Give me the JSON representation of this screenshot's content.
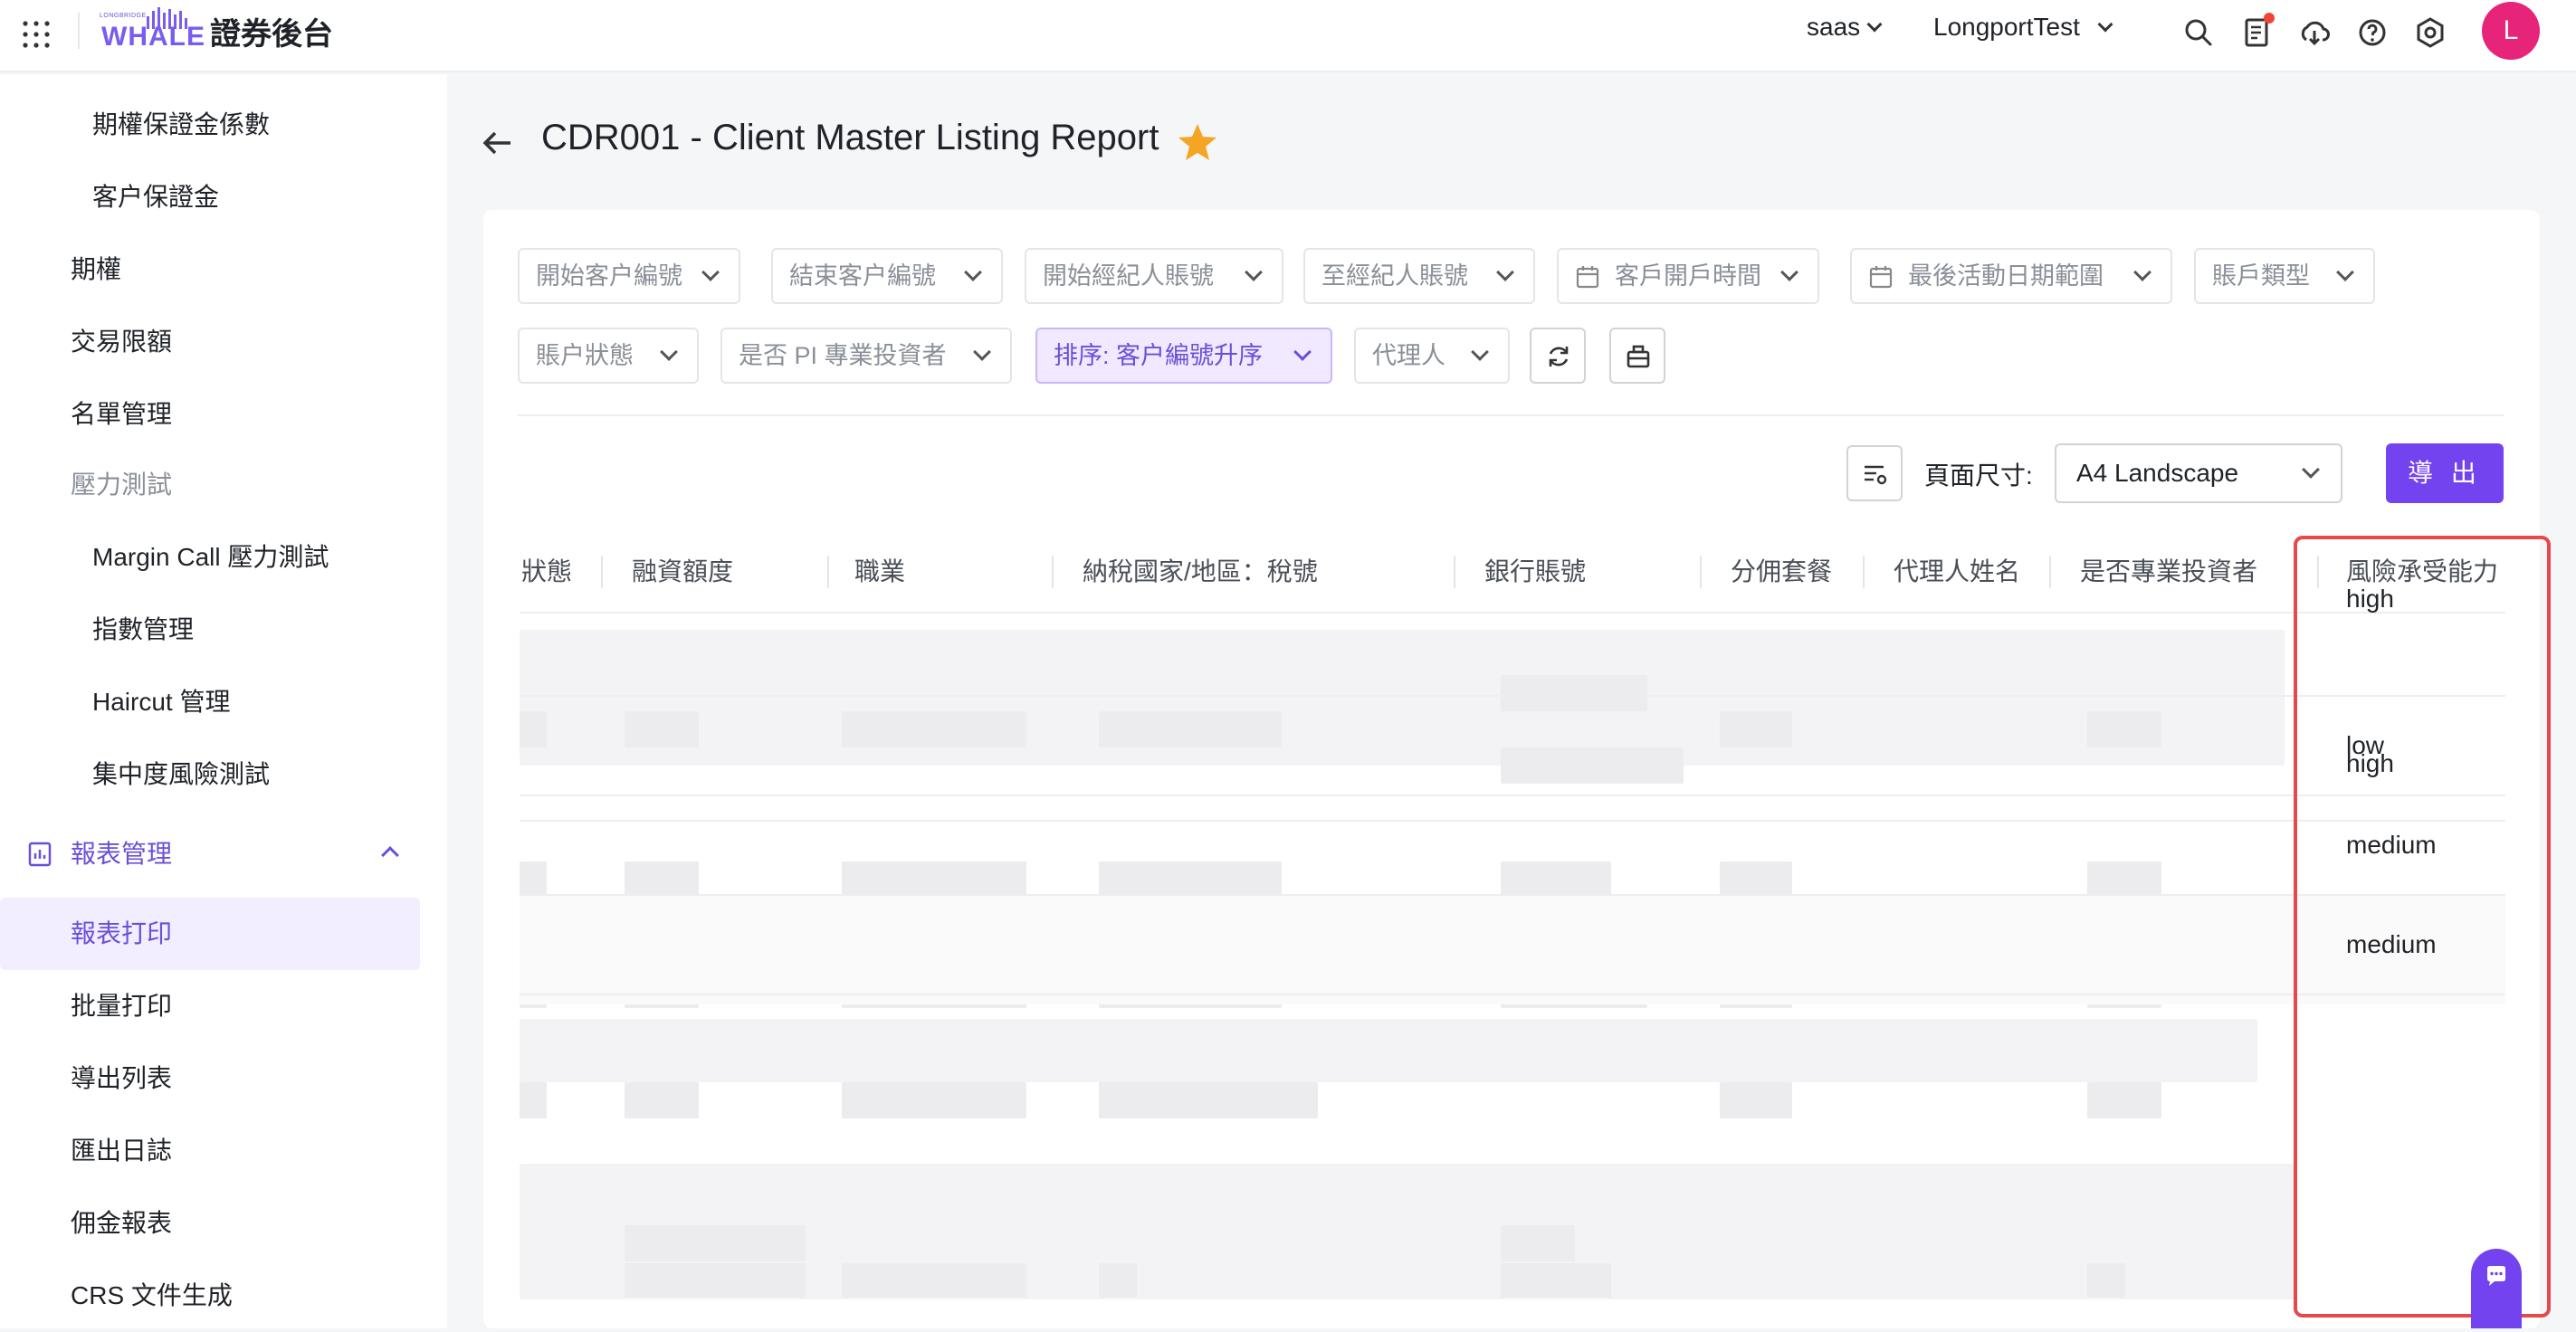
{
  "topbar": {
    "logo_small": "LONGBRIDGE",
    "logo_text": "WHALE",
    "app_title": "證券後台",
    "tenant": "saas",
    "account": "LongportTest",
    "avatar_letter": "L"
  },
  "sidebar": {
    "items": [
      {
        "label": "期權保證金係數"
      },
      {
        "label": "客户保證金"
      },
      {
        "label": "期權"
      },
      {
        "label": "交易限額"
      },
      {
        "label": "名單管理"
      },
      {
        "label": "壓力測試"
      },
      {
        "label": "Margin Call 壓力測試"
      },
      {
        "label": "指數管理"
      },
      {
        "label": "Haircut 管理"
      },
      {
        "label": "集中度風險測試"
      },
      {
        "label": "報表管理"
      },
      {
        "label": "報表打印"
      },
      {
        "label": "批量打印"
      },
      {
        "label": "導出列表"
      },
      {
        "label": "匯出日誌"
      },
      {
        "label": "佣金報表"
      },
      {
        "label": "CRS 文件生成"
      }
    ]
  },
  "page": {
    "title": "CDR001 - Client Master Listing Report"
  },
  "filters": {
    "start_client": "開始客户編號",
    "end_client": "結束客户編號",
    "start_broker": "開始經紀人賬號",
    "to_broker": "至經紀人賬號",
    "open_time": "客戶開戶時間",
    "last_active": "最後活動日期範圍",
    "account_type": "賬戶類型",
    "account_status": "賬户狀態",
    "is_pi": "是否 PI 專業投資者",
    "sort": "排序: 客户編號升序",
    "agent": "代理人"
  },
  "toolbar": {
    "page_size_label": "頁面尺寸:",
    "page_size_value": "A4 Landscape",
    "export_label": "導 出"
  },
  "table": {
    "columns": [
      "狀態",
      "融資額度",
      "職業",
      "納稅國家/地區：稅號",
      "銀行賬號",
      "分佣套餐",
      "代理人姓名",
      "是否專業投資者",
      "風險承受能力"
    ],
    "risk_values": [
      "high",
      "low",
      "medium",
      "medium",
      "high"
    ]
  }
}
